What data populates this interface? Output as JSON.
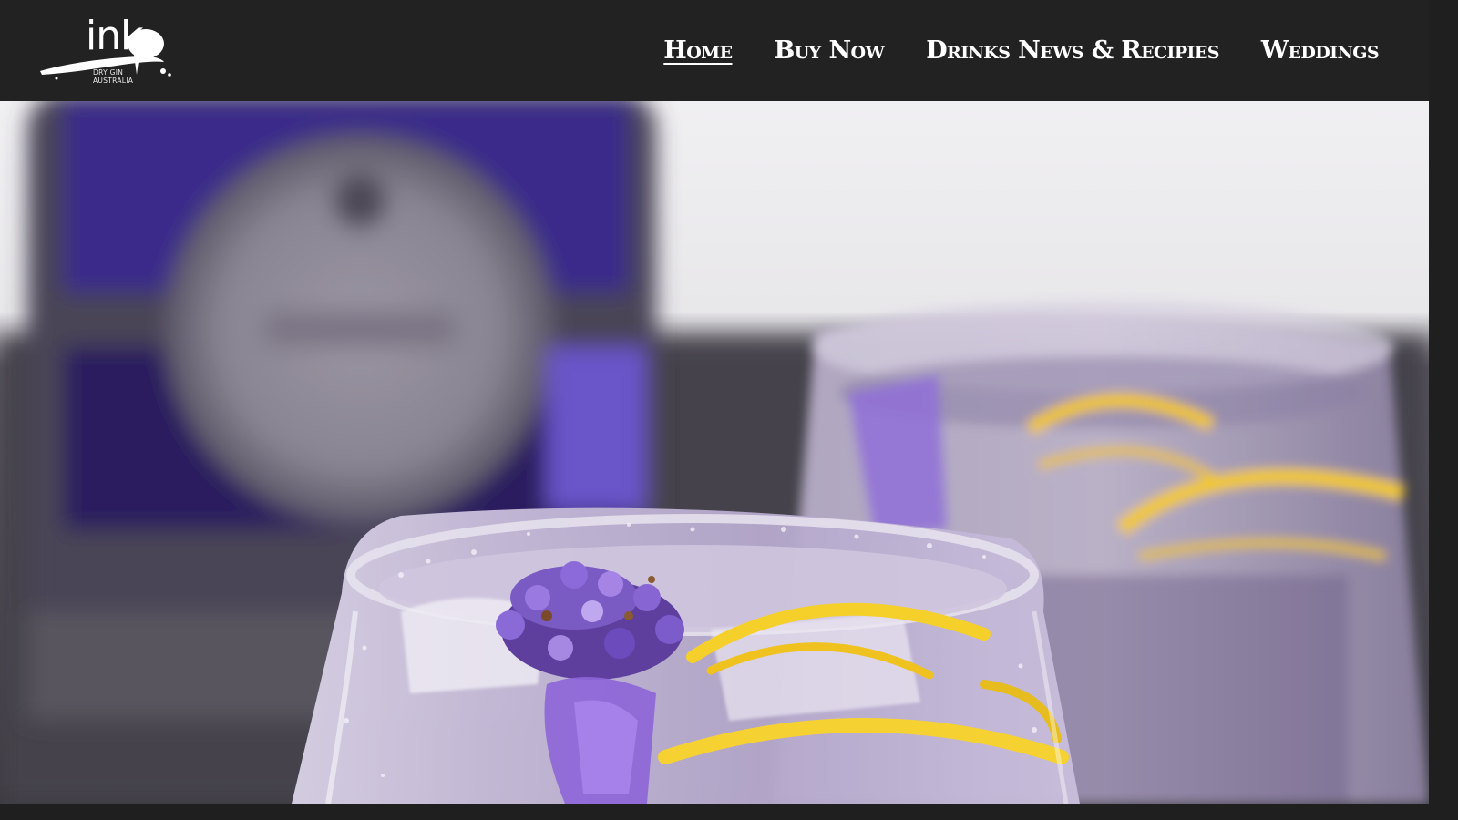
{
  "brand": {
    "name": "ink",
    "tagline_line1": "Dry Gin",
    "tagline_line2": "Australia"
  },
  "nav": {
    "items": [
      {
        "label": "Home",
        "active": true
      },
      {
        "label": "Buy Now",
        "active": false
      },
      {
        "label": "Drinks News & Recipies",
        "active": false
      },
      {
        "label": "Weddings",
        "active": false
      }
    ]
  },
  "hero": {
    "image": "lavender-gin-and-tonic-cocktail-photo"
  },
  "colors": {
    "header_bg": "#222222",
    "nav_text": "#ffffff",
    "accent_purple": "#6a4fb8",
    "lemon": "#f2cc2c"
  }
}
